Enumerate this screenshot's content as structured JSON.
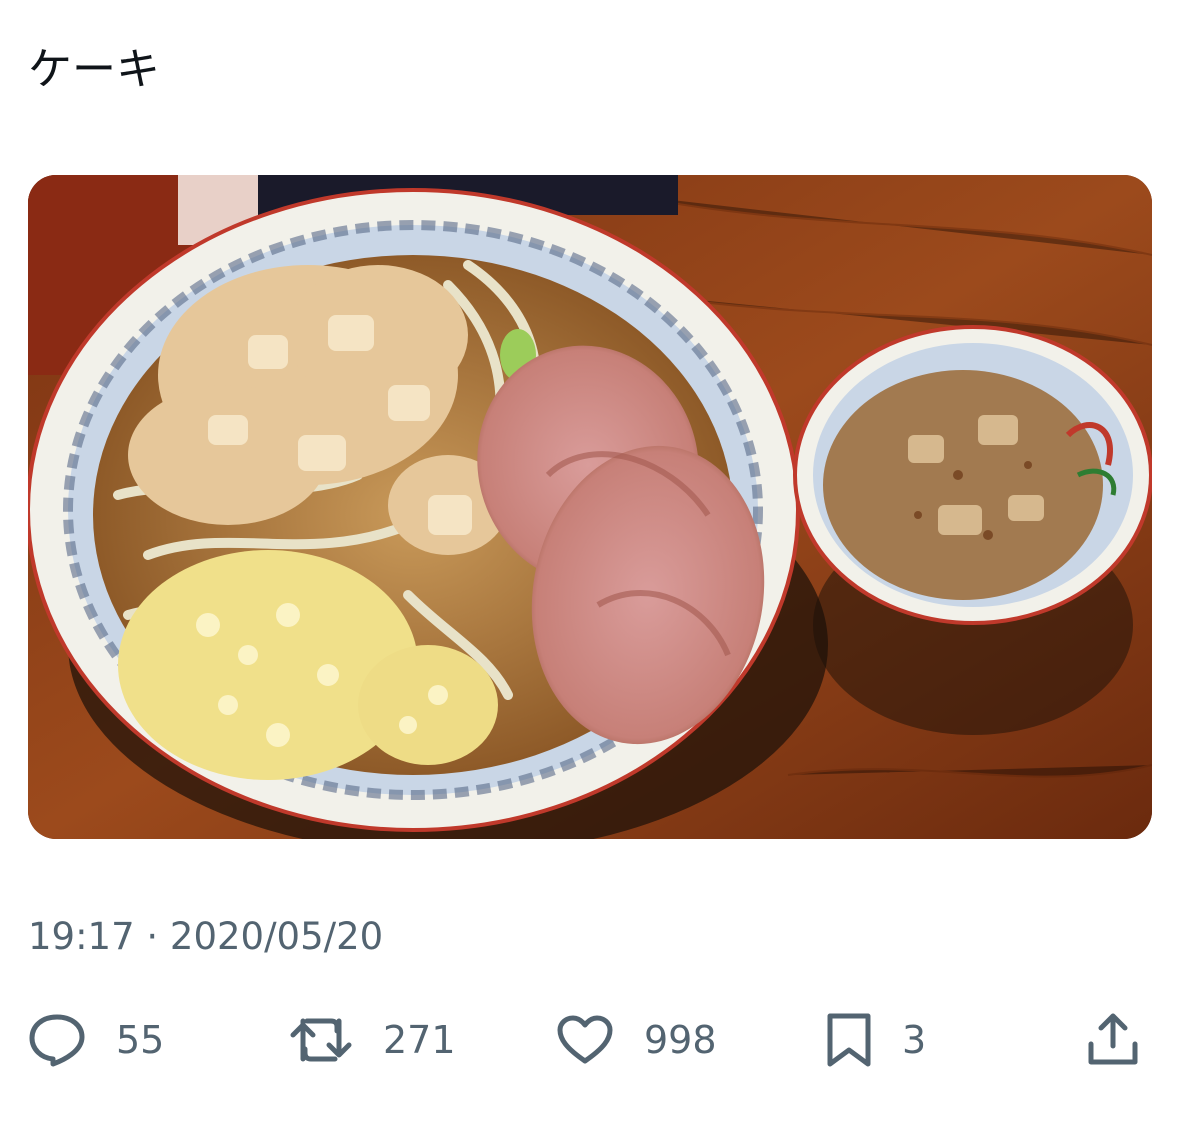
{
  "tweet": {
    "text": "ケーキ",
    "timestamp": "19:17 · 2020/05/20"
  },
  "actions": {
    "replies": "55",
    "retweets": "271",
    "likes": "998",
    "bookmarks": "3"
  },
  "colors": {
    "text_primary": "#0f1419",
    "text_secondary": "#536471"
  },
  "icons": [
    "reply-icon",
    "retweet-icon",
    "like-icon",
    "bookmark-icon",
    "share-icon"
  ]
}
